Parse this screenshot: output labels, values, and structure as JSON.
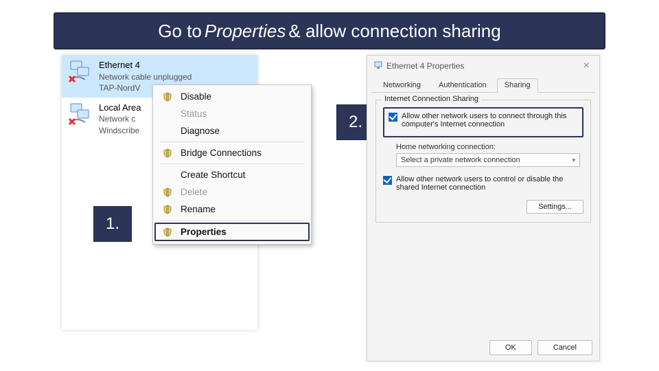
{
  "title": {
    "pre": "Go to",
    "em": "Properties",
    "post": "& allow connection sharing"
  },
  "steps": {
    "one": "1.",
    "two": "2."
  },
  "network_list": [
    {
      "name": "Ethernet 4",
      "line2": "Network cable unplugged",
      "line3": "TAP-NordV"
    },
    {
      "name": "Local Area",
      "line2": "Network c",
      "line3": "Windscribe"
    }
  ],
  "context_menu": {
    "disable": "Disable",
    "status": "Status",
    "diagnose": "Diagnose",
    "bridge": "Bridge Connections",
    "shortcut": "Create Shortcut",
    "delete": "Delete",
    "rename": "Rename",
    "properties": "Properties"
  },
  "dialog": {
    "title": "Ethernet 4 Properties",
    "tabs": {
      "networking": "Networking",
      "auth": "Authentication",
      "sharing": "Sharing"
    },
    "group_legend": "Internet Connection Sharing",
    "allow_connect": "Allow other network users to connect through this computer's Internet connection",
    "home_label": "Home networking connection:",
    "select_placeholder": "Select a private network connection",
    "allow_control": "Allow other network users to control or disable the shared Internet connection",
    "settings_btn": "Settings...",
    "ok": "OK",
    "cancel": "Cancel"
  }
}
